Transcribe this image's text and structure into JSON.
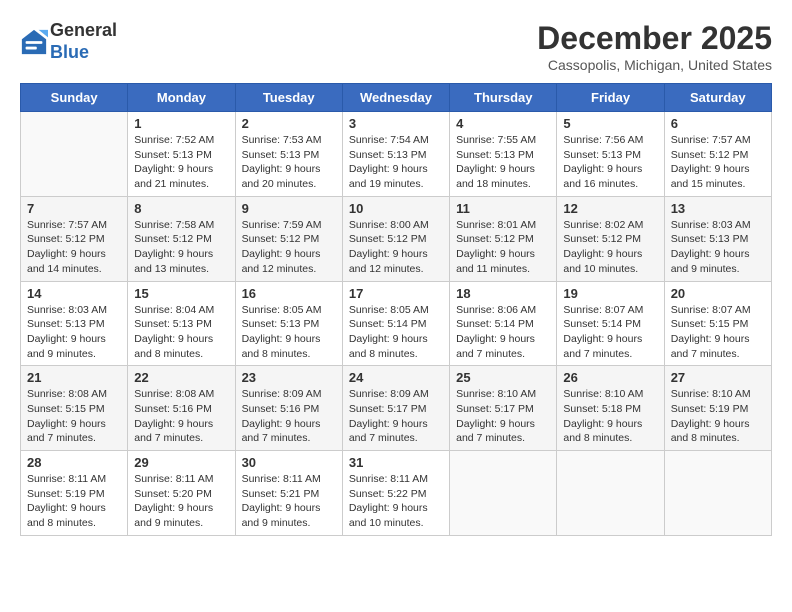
{
  "header": {
    "logo": {
      "line1": "General",
      "line2": "Blue"
    },
    "title": "December 2025",
    "location": "Cassopolis, Michigan, United States"
  },
  "weekdays": [
    "Sunday",
    "Monday",
    "Tuesday",
    "Wednesday",
    "Thursday",
    "Friday",
    "Saturday"
  ],
  "weeks": [
    [
      {
        "day": "",
        "info": ""
      },
      {
        "day": "1",
        "info": "Sunrise: 7:52 AM\nSunset: 5:13 PM\nDaylight: 9 hours\nand 21 minutes."
      },
      {
        "day": "2",
        "info": "Sunrise: 7:53 AM\nSunset: 5:13 PM\nDaylight: 9 hours\nand 20 minutes."
      },
      {
        "day": "3",
        "info": "Sunrise: 7:54 AM\nSunset: 5:13 PM\nDaylight: 9 hours\nand 19 minutes."
      },
      {
        "day": "4",
        "info": "Sunrise: 7:55 AM\nSunset: 5:13 PM\nDaylight: 9 hours\nand 18 minutes."
      },
      {
        "day": "5",
        "info": "Sunrise: 7:56 AM\nSunset: 5:13 PM\nDaylight: 9 hours\nand 16 minutes."
      },
      {
        "day": "6",
        "info": "Sunrise: 7:57 AM\nSunset: 5:12 PM\nDaylight: 9 hours\nand 15 minutes."
      }
    ],
    [
      {
        "day": "7",
        "info": "Sunrise: 7:57 AM\nSunset: 5:12 PM\nDaylight: 9 hours\nand 14 minutes."
      },
      {
        "day": "8",
        "info": "Sunrise: 7:58 AM\nSunset: 5:12 PM\nDaylight: 9 hours\nand 13 minutes."
      },
      {
        "day": "9",
        "info": "Sunrise: 7:59 AM\nSunset: 5:12 PM\nDaylight: 9 hours\nand 12 minutes."
      },
      {
        "day": "10",
        "info": "Sunrise: 8:00 AM\nSunset: 5:12 PM\nDaylight: 9 hours\nand 12 minutes."
      },
      {
        "day": "11",
        "info": "Sunrise: 8:01 AM\nSunset: 5:12 PM\nDaylight: 9 hours\nand 11 minutes."
      },
      {
        "day": "12",
        "info": "Sunrise: 8:02 AM\nSunset: 5:12 PM\nDaylight: 9 hours\nand 10 minutes."
      },
      {
        "day": "13",
        "info": "Sunrise: 8:03 AM\nSunset: 5:13 PM\nDaylight: 9 hours\nand 9 minutes."
      }
    ],
    [
      {
        "day": "14",
        "info": "Sunrise: 8:03 AM\nSunset: 5:13 PM\nDaylight: 9 hours\nand 9 minutes."
      },
      {
        "day": "15",
        "info": "Sunrise: 8:04 AM\nSunset: 5:13 PM\nDaylight: 9 hours\nand 8 minutes."
      },
      {
        "day": "16",
        "info": "Sunrise: 8:05 AM\nSunset: 5:13 PM\nDaylight: 9 hours\nand 8 minutes."
      },
      {
        "day": "17",
        "info": "Sunrise: 8:05 AM\nSunset: 5:14 PM\nDaylight: 9 hours\nand 8 minutes."
      },
      {
        "day": "18",
        "info": "Sunrise: 8:06 AM\nSunset: 5:14 PM\nDaylight: 9 hours\nand 7 minutes."
      },
      {
        "day": "19",
        "info": "Sunrise: 8:07 AM\nSunset: 5:14 PM\nDaylight: 9 hours\nand 7 minutes."
      },
      {
        "day": "20",
        "info": "Sunrise: 8:07 AM\nSunset: 5:15 PM\nDaylight: 9 hours\nand 7 minutes."
      }
    ],
    [
      {
        "day": "21",
        "info": "Sunrise: 8:08 AM\nSunset: 5:15 PM\nDaylight: 9 hours\nand 7 minutes."
      },
      {
        "day": "22",
        "info": "Sunrise: 8:08 AM\nSunset: 5:16 PM\nDaylight: 9 hours\nand 7 minutes."
      },
      {
        "day": "23",
        "info": "Sunrise: 8:09 AM\nSunset: 5:16 PM\nDaylight: 9 hours\nand 7 minutes."
      },
      {
        "day": "24",
        "info": "Sunrise: 8:09 AM\nSunset: 5:17 PM\nDaylight: 9 hours\nand 7 minutes."
      },
      {
        "day": "25",
        "info": "Sunrise: 8:10 AM\nSunset: 5:17 PM\nDaylight: 9 hours\nand 7 minutes."
      },
      {
        "day": "26",
        "info": "Sunrise: 8:10 AM\nSunset: 5:18 PM\nDaylight: 9 hours\nand 8 minutes."
      },
      {
        "day": "27",
        "info": "Sunrise: 8:10 AM\nSunset: 5:19 PM\nDaylight: 9 hours\nand 8 minutes."
      }
    ],
    [
      {
        "day": "28",
        "info": "Sunrise: 8:11 AM\nSunset: 5:19 PM\nDaylight: 9 hours\nand 8 minutes."
      },
      {
        "day": "29",
        "info": "Sunrise: 8:11 AM\nSunset: 5:20 PM\nDaylight: 9 hours\nand 9 minutes."
      },
      {
        "day": "30",
        "info": "Sunrise: 8:11 AM\nSunset: 5:21 PM\nDaylight: 9 hours\nand 9 minutes."
      },
      {
        "day": "31",
        "info": "Sunrise: 8:11 AM\nSunset: 5:22 PM\nDaylight: 9 hours\nand 10 minutes."
      },
      {
        "day": "",
        "info": ""
      },
      {
        "day": "",
        "info": ""
      },
      {
        "day": "",
        "info": ""
      }
    ]
  ]
}
